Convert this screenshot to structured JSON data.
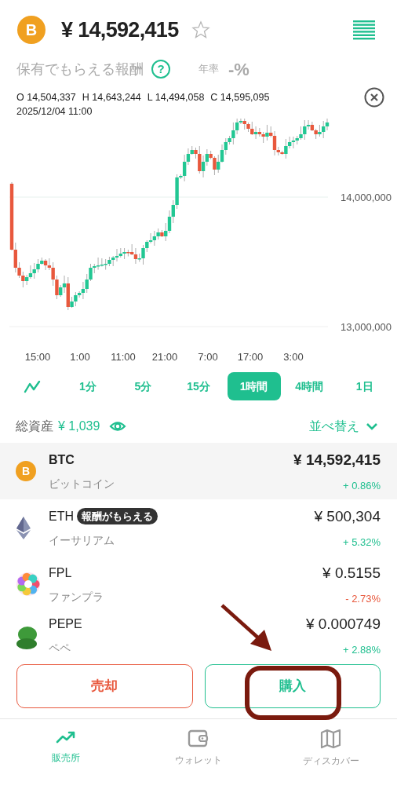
{
  "header": {
    "coin_glyph": "B",
    "price": "¥ 14,592,415",
    "favorite": false
  },
  "reward": {
    "label": "保有でもらえる報酬",
    "help": "?",
    "rate_label": "年率",
    "rate": "-%"
  },
  "ohlc": {
    "open": "O 14,504,337",
    "high": "H 14,643,244",
    "low": "L 14,494,058",
    "close": "C 14,595,095",
    "time": "2025/12/04 11:00"
  },
  "chart": {
    "y_labels": [
      "14,000,000",
      "13,000,000"
    ],
    "x_labels": [
      "15:00",
      "1:00",
      "11:00",
      "21:00",
      "7:00",
      "17:00",
      "3:00"
    ]
  },
  "timeframes": [
    {
      "label": "1分",
      "selected": false
    },
    {
      "label": "5分",
      "selected": false
    },
    {
      "label": "15分",
      "selected": false
    },
    {
      "label": "1時間",
      "selected": true
    },
    {
      "label": "4時間",
      "selected": false
    },
    {
      "label": "1日",
      "selected": false
    }
  ],
  "assets": {
    "label": "総資産",
    "amount": "¥ 1,039",
    "sort": "並べ替え"
  },
  "coins": [
    {
      "kind": "bitcoin",
      "glyph": "B",
      "symbol": "BTC",
      "name": "ビットコイン",
      "price": "¥ 14,592,415",
      "change": "+ 0.86%",
      "color": "#1fbf8f",
      "selected": true
    },
    {
      "kind": "ethereum",
      "symbol": "ETH",
      "badge": "報酬がもらえる",
      "name": "イーサリアム",
      "price": "¥ 500,304",
      "change": "+ 5.32%",
      "color": "#1fbf8f",
      "selected": false
    },
    {
      "kind": "fanpla",
      "symbol": "FPL",
      "name": "ファンプラ",
      "price": "¥ 0.5155",
      "change": "- 2.73%",
      "color": "#e8583d",
      "selected": false
    },
    {
      "kind": "pepe",
      "symbol": "PEPE",
      "name": "ペペ",
      "price": "¥ 0.000749",
      "change": "+ 2.88%",
      "color": "#1fbf8f",
      "selected": false
    }
  ],
  "actions": {
    "sell": "売却",
    "buy": "購入"
  },
  "nav": [
    {
      "kind": "trend",
      "label": "販売所",
      "selected": true
    },
    {
      "kind": "wallet",
      "label": "ウォレット",
      "selected": false
    },
    {
      "kind": "map",
      "label": "ディスカバー",
      "selected": false
    }
  ]
}
